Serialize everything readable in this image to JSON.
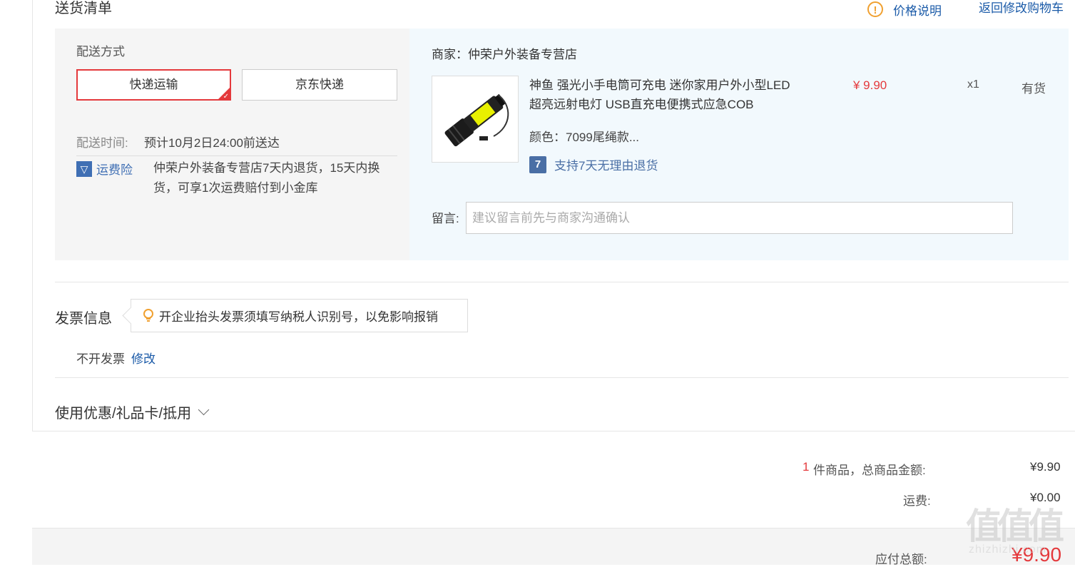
{
  "header": {
    "title": "送货清单",
    "price_note": "价格说明",
    "back_to_cart": "返回修改购物车"
  },
  "shipping": {
    "label": "配送方式",
    "options": [
      "快递运输",
      "京东快递"
    ],
    "selected": "快递运输",
    "time_label": "配送时间:",
    "time_value": "预计10月2日24:00前送达",
    "insurance_label": "运费险",
    "insurance_desc": "仲荣户外装备专营店7天内退货，15天内换货，可享1次运费赔付到小金库"
  },
  "merchant": {
    "name": "商家：仲荣户外装备专营店",
    "product": {
      "title": "神鱼 强光小手电筒可充电 迷你家用户外小型LED超亮远射电灯 USB直充电便携式应急COB",
      "price": "¥ 9.90",
      "qty": "x1",
      "stock": "有货",
      "color": "颜色：7099尾绳款...",
      "return_badge": "7",
      "return_policy": "支持7天无理由退货"
    },
    "message_label": "留言:",
    "message_placeholder": "建议留言前先与商家沟通确认"
  },
  "invoice": {
    "title": "发票信息",
    "tip": "开企业抬头发票须填写纳税人识别号，以免影响报销",
    "status": "不开发票",
    "edit": "修改"
  },
  "coupon": {
    "label": "使用优惠/礼品卡/抵用"
  },
  "summary": {
    "count": "1",
    "goods_label": "件商品，总商品金额:",
    "goods_value": "¥9.90",
    "freight_label": "运费:",
    "freight_value": "¥0.00",
    "total_label": "应付总额:",
    "total_value": "¥9.90"
  },
  "watermark": {
    "glyphs": "值值值",
    "url": "zhizhizhi.com"
  },
  "colors": {
    "accent_red": "#e4393c",
    "link_blue": "#1a5aa8",
    "warn_orange": "#f0a030"
  }
}
